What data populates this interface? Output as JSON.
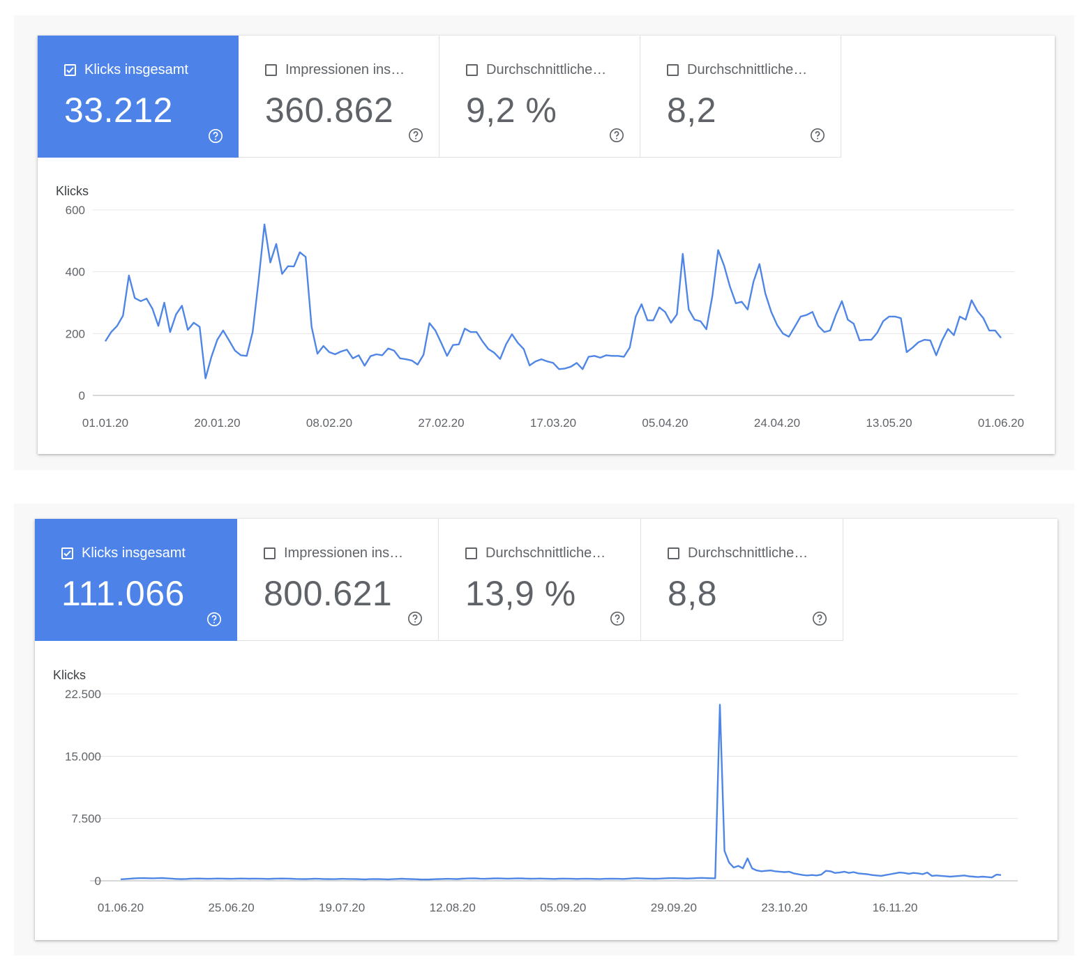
{
  "colors": {
    "accent": "#4d83e8",
    "line": "#4f86e6",
    "grid": "#e6e6e6",
    "text_muted": "#5f6368"
  },
  "panels": [
    {
      "metrics": [
        {
          "label": "Klicks insgesamt",
          "value": "33.212",
          "checked": true,
          "icon": "help-circle-icon"
        },
        {
          "label": "Impressionen ins…",
          "value": "360.862",
          "checked": false,
          "icon": "help-circle-icon"
        },
        {
          "label": "Durchschnittliche…",
          "value": "9,2 %",
          "checked": false,
          "icon": "help-circle-icon"
        },
        {
          "label": "Durchschnittliche…",
          "value": "8,2",
          "checked": false,
          "icon": "help-circle-icon"
        }
      ],
      "chart_data": {
        "type": "line",
        "ylabel": "Klicks",
        "ylim": [
          0,
          600
        ],
        "yticks": [
          0,
          200,
          400,
          600
        ],
        "ytick_labels": [
          "0",
          "200",
          "400",
          "600"
        ],
        "xticks": [
          "01.01.20",
          "20.01.20",
          "08.02.20",
          "27.02.20",
          "17.03.20",
          "05.04.20",
          "24.04.20",
          "13.05.20",
          "01.06.20"
        ],
        "x_start": "01.01.20",
        "x_end": "01.06.20",
        "grid": true,
        "series": [
          {
            "values": [
              175,
              205,
              225,
              258,
              388,
              315,
              305,
              313,
              280,
              225,
              300,
              205,
              262,
              290,
              212,
              235,
              222,
              55,
              125,
              180,
              210,
              178,
              145,
              130,
              128,
              205,
              370,
              553,
              430,
              490,
              393,
              418,
              417,
              463,
              448,
              222,
              135,
              160,
              140,
              133,
              142,
              148,
              120,
              130,
              96,
              127,
              133,
              130,
              152,
              145,
              120,
              117,
              113,
              100,
              132,
              234,
              210,
              170,
              128,
              163,
              165,
              216,
              205,
              205,
              175,
              150,
              138,
              118,
              165,
              198,
              170,
              150,
              97,
              110,
              117,
              110,
              105,
              85,
              87,
              93,
              105,
              85,
              125,
              128,
              122,
              130,
              128,
              128,
              125,
              155,
              255,
              295,
              243,
              243,
              285,
              270,
              235,
              262,
              458,
              278,
              245,
              240,
              214,
              320,
              470,
              420,
              352,
              298,
              303,
              278,
              368,
              425,
              330,
              270,
              228,
              200,
              190,
              222,
              255,
              260,
              270,
              225,
              205,
              210,
              262,
              305,
              245,
              232,
              178,
              180,
              180,
              203,
              240,
              255,
              255,
              250,
              140,
              155,
              172,
              180,
              178,
              130,
              178,
              215,
              195,
              255,
              245,
              308,
              273,
              250,
              210,
              210,
              186
            ]
          }
        ]
      }
    },
    {
      "metrics": [
        {
          "label": "Klicks insgesamt",
          "value": "111.066",
          "checked": true,
          "icon": "help-circle-icon"
        },
        {
          "label": "Impressionen ins…",
          "value": "800.621",
          "checked": false,
          "icon": "help-circle-icon"
        },
        {
          "label": "Durchschnittliche…",
          "value": "13,9 %",
          "checked": false,
          "icon": "help-circle-icon"
        },
        {
          "label": "Durchschnittliche…",
          "value": "8,8",
          "checked": false,
          "icon": "help-circle-icon"
        }
      ],
      "chart_data": {
        "type": "line",
        "ylabel": "Klicks",
        "ylim": [
          0,
          22500
        ],
        "yticks": [
          0,
          7500,
          15000,
          22500
        ],
        "ytick_labels": [
          "0",
          "7.500",
          "15.000",
          "22.500"
        ],
        "xticks": [
          "01.06.20",
          "25.06.20",
          "19.07.20",
          "12.08.20",
          "05.09.20",
          "29.09.20",
          "23.10.20",
          "16.11.20"
        ],
        "x_start": "01.06.20",
        "x_end": "08.12.20",
        "grid": true,
        "series": [
          {
            "values": [
              186,
              220,
              260,
              300,
              320,
              330,
              310,
              300,
              320,
              340,
              300,
              270,
              230,
              210,
              220,
              250,
              270,
              280,
              260,
              240,
              260,
              280,
              270,
              250,
              240,
              260,
              280,
              270,
              250,
              270,
              260,
              240,
              230,
              250,
              270,
              280,
              270,
              250,
              230,
              220,
              210,
              230,
              250,
              240,
              220,
              210,
              200,
              220,
              240,
              230,
              220,
              210,
              190,
              180,
              200,
              220,
              210,
              190,
              180,
              200,
              230,
              250,
              230,
              210,
              190,
              170,
              160,
              170,
              190,
              210,
              230,
              240,
              230,
              210,
              250,
              280,
              300,
              290,
              260,
              240,
              270,
              290,
              300,
              280,
              260,
              280,
              300,
              290,
              270,
              250,
              260,
              280,
              260,
              240,
              230,
              250,
              270,
              260,
              240,
              230,
              240,
              250,
              240,
              230,
              220,
              240,
              260,
              250,
              240,
              230,
              260,
              300,
              320,
              300,
              280,
              260,
              250,
              270,
              300,
              320,
              330,
              310,
              290,
              280,
              300,
              330,
              350,
              330,
              310,
              300,
              21200,
              3600,
              2200,
              1600,
              1800,
              1500,
              2700,
              1500,
              1250,
              1150,
              1200,
              1250,
              1150,
              1100,
              1050,
              1100,
              900,
              800,
              700,
              650,
              700,
              650,
              750,
              1200,
              1150,
              950,
              1000,
              1100,
              950,
              1050,
              900,
              850,
              800,
              700,
              650,
              600,
              700,
              800,
              900,
              1000,
              950,
              850,
              950,
              900,
              800,
              1000,
              600,
              650,
              600,
              550,
              500,
              550,
              600,
              650,
              550,
              500,
              450,
              500,
              450,
              400,
              750,
              700
            ]
          }
        ]
      }
    }
  ]
}
